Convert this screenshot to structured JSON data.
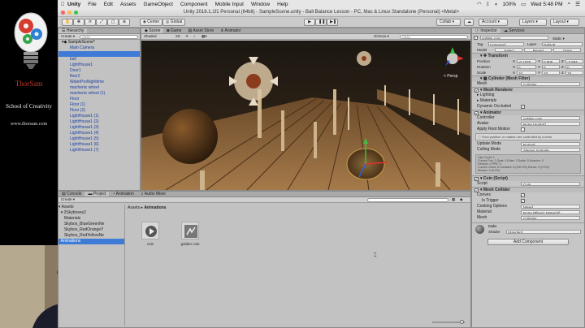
{
  "brand": {
    "title": "ThorSam",
    "subtitle": "School of Creativity",
    "website": "www.thorsam.com"
  },
  "menubar": {
    "app": "Unity",
    "items": [
      "File",
      "Edit",
      "Assets",
      "GameObject",
      "Component",
      "Mobile Input",
      "Window",
      "Help"
    ],
    "battery": "100%",
    "clock": "Wed 5:48 PM"
  },
  "window": {
    "title": "Unity 2018.1.1f1 Personal (64bit) - SampleScene.unity - Ball Balance Lesson - PC, Mac & Linux Standalone (Personal) <Metal>"
  },
  "toolbar": {
    "center": "Center",
    "global": "Global",
    "collab": "Collab ▾",
    "account": "Account ▾",
    "layers": "Layers ▾",
    "layout": "Layout ▾"
  },
  "hierarchy": {
    "tab": "Hierarchy",
    "create": "Create ▾",
    "search_placeholder": "Q▾All",
    "scene": "SampleScene*",
    "items": [
      {
        "label": "Main Camera",
        "selected": false
      },
      {
        "label": "",
        "selected": true
      },
      {
        "label": "ball",
        "selected": false
      },
      {
        "label": "LightHouse1",
        "selected": false
      },
      {
        "label": "Door1",
        "selected": false
      },
      {
        "label": "floor2",
        "selected": false
      },
      {
        "label": "WaterProNighttime",
        "selected": false
      },
      {
        "label": "machenic wheel",
        "selected": false
      },
      {
        "label": "machenic wheel (1)",
        "selected": false
      },
      {
        "label": "Floor",
        "selected": false
      },
      {
        "label": "Floor (1)",
        "selected": false
      },
      {
        "label": "Floor (2)",
        "selected": false
      },
      {
        "label": "LightHouse1 (1)",
        "selected": false
      },
      {
        "label": "LightHouse1 (2)",
        "selected": false
      },
      {
        "label": "LightHouse1 (3)",
        "selected": false
      },
      {
        "label": "LightHouse1 (4)",
        "selected": false
      },
      {
        "label": "LightHouse1 (5)",
        "selected": false
      },
      {
        "label": "LightHouse1 (6)",
        "selected": false
      },
      {
        "label": "LightHouse1 (7)",
        "selected": false
      }
    ]
  },
  "scene": {
    "tabs": [
      "Scene",
      "Game",
      "Asset Store",
      "Animator"
    ],
    "shading": "Shaded",
    "gizmos": "Gizmos ▾",
    "search_placeholder": "Q▾All",
    "persp": "< Persp"
  },
  "inspector": {
    "tabs": [
      "Inspector",
      "Services"
    ],
    "object_name": "golden coin",
    "static_label": "Static ▾",
    "tag_label": "Tag",
    "tag": "Untagged",
    "layer_label": "Layer",
    "layer": "Default",
    "model_label": "Model",
    "model_buttons": [
      "Select",
      "Revert",
      "Open"
    ],
    "transform": {
      "header": "Transform",
      "position_label": "Position",
      "position": [
        "-0.1676",
        "0.906",
        "-3.594"
      ],
      "rotation_label": "Rotation",
      "rotation": [
        "0",
        "0",
        "0"
      ],
      "scale_label": "Scale",
      "scale": [
        "10",
        "10",
        "10"
      ]
    },
    "mesh_filter": {
      "header": "Cylinder (Mesh Filter)",
      "mesh_label": "Mesh",
      "mesh": "Cylinder"
    },
    "mesh_renderer": {
      "header": "Mesh Renderer",
      "lighting": "▸ Lighting",
      "materials": "▸ Materials",
      "dynamic_occluded": "Dynamic Occluded"
    },
    "animator": {
      "header": "Animator",
      "controller_label": "Controller",
      "controller": "golden coin",
      "avatar_label": "Avatar",
      "avatar": "None (Avatar)",
      "root_motion_label": "Apply Root Motion",
      "root_motion_note": "Root position or rotation are controlled by curves",
      "update_mode_label": "Update Mode",
      "update_mode": "Normal",
      "culling_mode_label": "Culling Mode",
      "culling_mode": "Always Animate",
      "clip_info": [
        "Clip Count: 1",
        "Curves Pos: 3 Quat: 0 Euler: 3 Scale: 0 Muscles: 0",
        "Generic: 0 PPtr: 0",
        "Curves Count: 6 Constant: 6 (100.0%) Dense: 0 (0.0%)",
        "Stream: 0 (0.0%)"
      ]
    },
    "coin_script": {
      "header": "Coin (Script)",
      "script_label": "Script",
      "script": "Coin"
    },
    "mesh_collider": {
      "header": "Mesh Collider",
      "convex_label": "Convex",
      "is_trigger_label": "Is Trigger",
      "cooking_label": "Cooking Options",
      "cooking": "Mixed...",
      "material_label": "Material",
      "material": "None (Physic Material)",
      "mesh_label": "Mesh",
      "mesh": "Cylinder"
    },
    "material": {
      "name": "Coin",
      "shader_label": "Shader",
      "shader": "Standard"
    },
    "add_component": "Add Component"
  },
  "project": {
    "tabs": [
      "Console",
      "Project",
      "Animation",
      "Audio Mixer"
    ],
    "create": "Create ▾",
    "tree": [
      {
        "label": "▾ Assets",
        "selected": false
      },
      {
        "label": "  ▾ 3Skyboxes2",
        "selected": false
      },
      {
        "label": "     Materials",
        "selected": false
      },
      {
        "label": "     Skybox_BlueGreenNe",
        "selected": false
      },
      {
        "label": "     Skybox_RedOrangeY",
        "selected": false
      },
      {
        "label": "     Skybox_RedYellowNe",
        "selected": false
      },
      {
        "label": "  Animations",
        "selected": true
      }
    ],
    "breadcrumb": [
      "Assets",
      "Animations"
    ],
    "assets": [
      {
        "label": "coin",
        "icon": "animation-clip-icon"
      },
      {
        "label": "golden coin",
        "icon": "animator-controller-icon"
      }
    ]
  },
  "colors": {
    "selection": "#3e7bd6",
    "panel": "#c2c2c2",
    "brand_red": "#c0392b"
  }
}
